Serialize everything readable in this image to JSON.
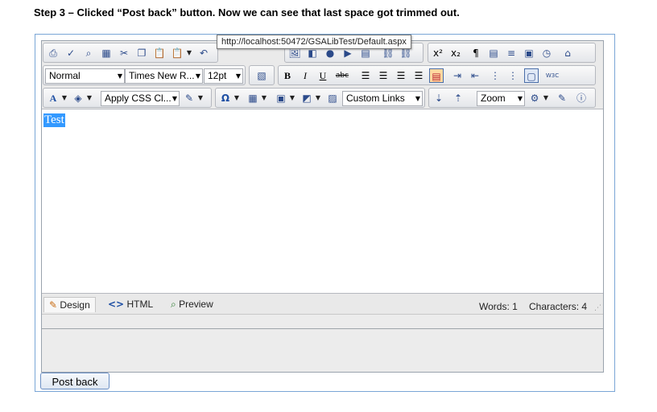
{
  "caption": "Step 3 – Clicked “Post back” button. Now we can see that last space got trimmed out.",
  "tooltip": "http://localhost:50472/GSALibTest/Default.aspx",
  "toolbar": {
    "paragraph_format": "Normal",
    "font_name": "Times New R...",
    "font_size": "12pt",
    "bold": "B",
    "italic": "I",
    "underline": "U",
    "strike": "abc",
    "css_class": "Apply CSS Cl...",
    "custom_links": "Custom Links",
    "zoom": "Zoom",
    "special_char": "Ω",
    "superscript": "x²",
    "subscript": "x₂",
    "paragraph_mark": "¶",
    "w3c": "W3C",
    "font_color": "A"
  },
  "content": {
    "text": "Test"
  },
  "modes": {
    "design": "Design",
    "html": "HTML",
    "preview": "Preview"
  },
  "status": {
    "words": "Words: 1",
    "characters": "Characters: 4"
  },
  "postback_label": "Post back",
  "colors": {
    "selection": "#3399ff",
    "border_accent": "#7aa6d6"
  }
}
